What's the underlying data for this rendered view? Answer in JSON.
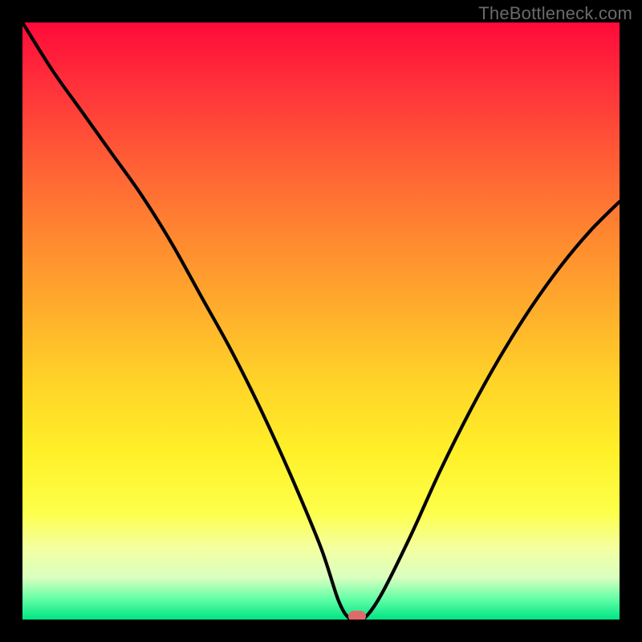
{
  "watermark": "TheBottleneck.com",
  "colors": {
    "frame": "#000000",
    "curve": "#000000",
    "marker": "#e06a6a"
  },
  "chart_data": {
    "type": "line",
    "title": "",
    "xlabel": "",
    "ylabel": "",
    "xlim": [
      0,
      100
    ],
    "ylim": [
      0,
      100
    ],
    "grid": false,
    "legend": false,
    "annotations": [
      {
        "text": "TheBottleneck.com",
        "pos": "top-right"
      }
    ],
    "series": [
      {
        "name": "bottleneck-curve",
        "x": [
          0,
          5,
          10,
          15,
          20,
          25,
          30,
          35,
          40,
          45,
          50,
          53,
          55,
          57,
          60,
          65,
          70,
          75,
          80,
          85,
          90,
          95,
          100
        ],
        "values": [
          100,
          92,
          85,
          78,
          71,
          63,
          54,
          45,
          35,
          24,
          12,
          3,
          0,
          0,
          4,
          14,
          25,
          35,
          44,
          52,
          59,
          65,
          70
        ]
      }
    ],
    "marker": {
      "x": 56,
      "y": 0
    },
    "background_gradient": {
      "top": "#ff0a3a",
      "mid": "#ffd328",
      "bottom": "#00e585"
    }
  }
}
